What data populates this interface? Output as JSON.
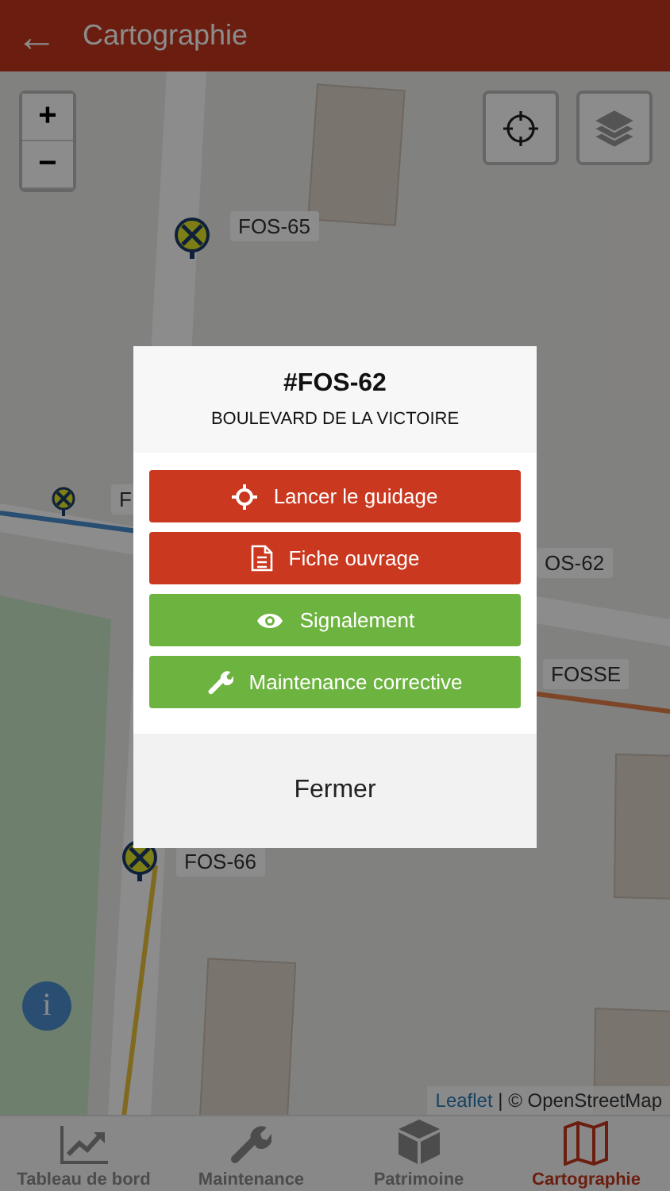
{
  "header": {
    "back_icon": "←",
    "title": "Cartographie"
  },
  "map": {
    "zoom": [
      "+",
      "−"
    ],
    "markers": [
      {
        "label": "FOS-65",
        "kind": "pin"
      },
      {
        "label": "F",
        "kind": "minipin"
      },
      {
        "label": "OS-62",
        "kind": "label"
      },
      {
        "label": "FOSSE",
        "kind": "label"
      },
      {
        "label": "FOS-66",
        "kind": "pin"
      }
    ],
    "info": "i",
    "attribution": {
      "link": "Leaflet",
      "text": "| © OpenStreetMap"
    }
  },
  "dialog": {
    "title": "#FOS-62",
    "subtitle": "BOULEVARD DE LA VICTOIRE",
    "actions": [
      {
        "label": "Lancer le guidage",
        "kind": "guide",
        "color": "#c9381f"
      },
      {
        "label": "Fiche ouvrage",
        "kind": "sheet",
        "color": "#c9381f"
      },
      {
        "label": "Signalement",
        "kind": "report",
        "color": "#6db33f"
      },
      {
        "label": "Maintenance corrective",
        "kind": "repair",
        "color": "#6db33f"
      }
    ],
    "close": "Fermer"
  },
  "tabs": [
    {
      "label": "Tableau de bord",
      "kind": "dashboard",
      "selected": false
    },
    {
      "label": "Maintenance",
      "kind": "maintenance",
      "selected": false
    },
    {
      "label": "Patrimoine",
      "kind": "assets",
      "selected": false
    },
    {
      "label": "Cartographie",
      "kind": "mapping",
      "selected": true
    }
  ]
}
